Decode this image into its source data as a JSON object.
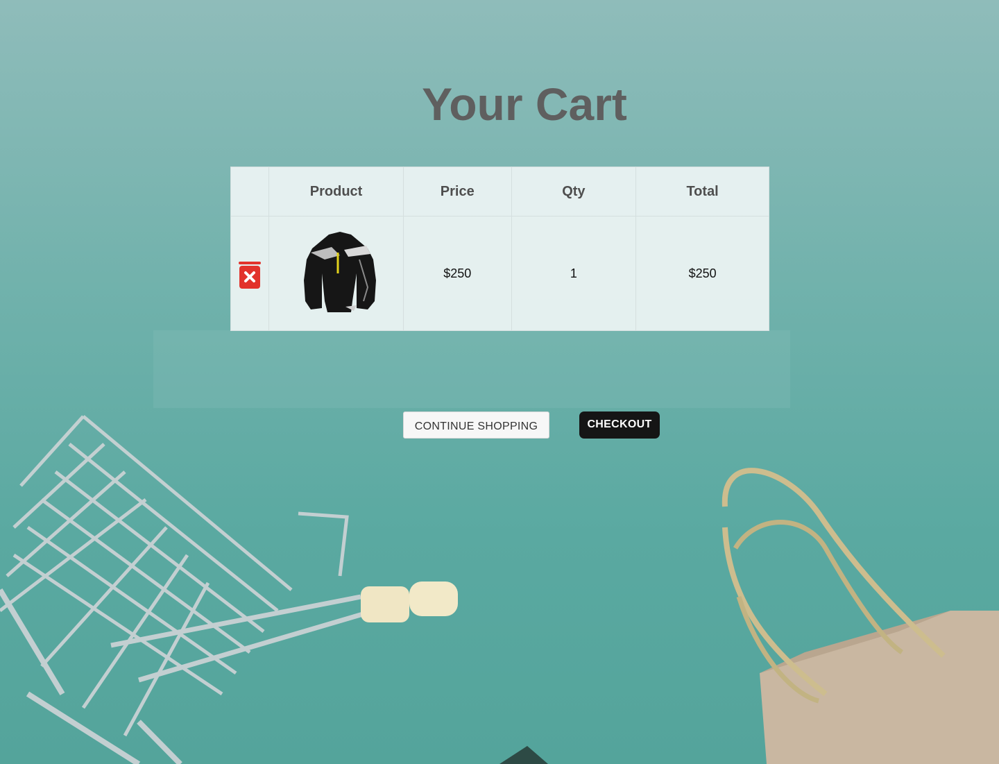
{
  "page": {
    "title": "Your Cart"
  },
  "cart": {
    "headers": {
      "product": "Product",
      "price": "Price",
      "qty": "Qty",
      "total": "Total"
    },
    "items": [
      {
        "price": "$250",
        "qty": "1",
        "total": "$250"
      }
    ]
  },
  "actions": {
    "continue_label": "CONTINUE SHOPPING",
    "checkout_label": "CHECKOUT"
  },
  "colors": {
    "background": "#6fb1ab",
    "title": "#5f5f5f",
    "delete_icon": "#e2322b",
    "checkout_button": "#151515"
  },
  "icons": {
    "remove_item": "trash-x-icon",
    "product_image": "jacket-image"
  }
}
